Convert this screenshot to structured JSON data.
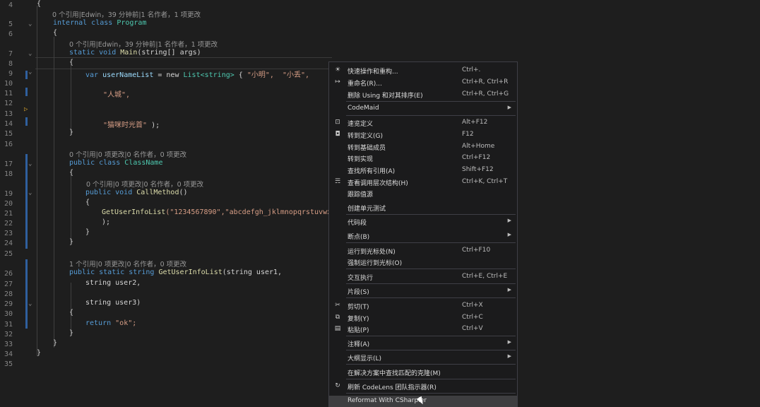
{
  "editor": {
    "line_numbers": [
      "4",
      "5",
      "6",
      "7",
      "8",
      "9",
      "10",
      "11",
      "12",
      "13",
      "14",
      "15",
      "16",
      "17",
      "18",
      "19",
      "20",
      "21",
      "22",
      "23",
      "24",
      "25",
      "26",
      "27",
      "28",
      "29",
      "30",
      "31",
      "32",
      "33",
      "34",
      "35"
    ],
    "codelens": {
      "program": "0 个引用|Edwin，39 分钟前|1 名作者，1 项更改",
      "main": "0 个引用|Edwin，39 分钟前|1 名作者，1 项更改",
      "classname": "0 个引用|0 项更改|0 名作者，0 项更改",
      "callmethod": "0 个引用|0 项更改|0 名作者，0 项更改",
      "getuserinfolist": "1 个引用|0 项更改|0 名作者，0 项更改"
    },
    "code": {
      "l4": "{",
      "l5_kw": "internal class",
      "l5_name": "Program",
      "l6": "{",
      "l7_kw": "static void",
      "l7_fn": "Main",
      "l7_rest": "(string[] args)",
      "l8": "{",
      "l9_a": "var",
      "l9_b": "userNameList",
      "l9_c": "= new",
      "l9_d": "List<string>",
      "l9_e": "{",
      "l9_s1": "\"小明\",",
      "l9_s2": "\"小丢\",",
      "l11": "\"人城\",",
      "l14_s": "\"猫咪时光首\"",
      "l14_end": ");",
      "l15": "}",
      "l17_kw": "public class",
      "l17_name": "ClassName",
      "l18": "{",
      "l19_kw": "public void",
      "l19_fn": "CallMethod",
      "l19_rest": "()",
      "l20": "{",
      "l21_fn": "GetUserInfoList",
      "l21_args": "(\"1234567890\",\"abcdefgh_jklmnopqrstuvwx",
      "l22": ");",
      "l23": "}",
      "l24": "}",
      "l26_kw": "public static string",
      "l26_fn": "GetUserInfoList",
      "l26_rest": "(string user1,",
      "l27": "string user2,",
      "l29": "string user3)",
      "l30": "{",
      "l31_kw": "return",
      "l31_s": "\"ok\";",
      "l32": "}",
      "l33": "}",
      "l34": "}"
    }
  },
  "context_menu": {
    "items": [
      {
        "icon": "lightbulb-icon",
        "glyph": "☀",
        "label": "快速操作和重构...",
        "shortcut": "Ctrl+."
      },
      {
        "icon": "rename-icon",
        "glyph": "↦",
        "label": "重命名(R)...",
        "shortcut": "Ctrl+R, Ctrl+R"
      },
      {
        "icon": "",
        "glyph": "",
        "label": "删除 Using 和对其排序(E)",
        "shortcut": "Ctrl+R, Ctrl+G"
      },
      {
        "icon": "",
        "glyph": "",
        "label": "CodeMaid",
        "shortcut": "",
        "submenu": true
      },
      {
        "icon": "peek-definition-icon",
        "glyph": "⊡",
        "label": "速览定义",
        "shortcut": "Alt+F12"
      },
      {
        "icon": "goto-definition-icon",
        "glyph": "◘",
        "label": "转到定义(G)",
        "shortcut": "F12"
      },
      {
        "icon": "",
        "glyph": "",
        "label": "转到基础成员",
        "shortcut": "Alt+Home"
      },
      {
        "icon": "",
        "glyph": "",
        "label": "转到实现",
        "shortcut": "Ctrl+F12"
      },
      {
        "icon": "",
        "glyph": "",
        "label": "查找所有引用(A)",
        "shortcut": "Shift+F12"
      },
      {
        "icon": "call-hierarchy-icon",
        "glyph": "☴",
        "label": "查看调用层次结构(H)",
        "shortcut": "Ctrl+K, Ctrl+T"
      },
      {
        "icon": "",
        "glyph": "",
        "label": "跟踪值源",
        "shortcut": ""
      },
      {
        "icon": "",
        "glyph": "",
        "label": "创建单元测试",
        "shortcut": ""
      },
      {
        "icon": "",
        "glyph": "",
        "label": "代码段",
        "shortcut": "",
        "submenu": true
      },
      {
        "icon": "",
        "glyph": "",
        "label": "断点(B)",
        "shortcut": "",
        "submenu": true
      },
      {
        "icon": "",
        "glyph": "",
        "label": "运行到光标处(N)",
        "shortcut": "Ctrl+F10"
      },
      {
        "icon": "",
        "glyph": "",
        "label": "强制运行到光标(O)",
        "shortcut": ""
      },
      {
        "icon": "",
        "glyph": "",
        "label": "交互执行",
        "shortcut": "Ctrl+E, Ctrl+E"
      },
      {
        "icon": "",
        "glyph": "",
        "label": "片段(S)",
        "shortcut": "",
        "submenu": true
      },
      {
        "icon": "cut-icon",
        "glyph": "✂",
        "label": "剪切(T)",
        "shortcut": "Ctrl+X"
      },
      {
        "icon": "copy-icon",
        "glyph": "⧉",
        "label": "复制(Y)",
        "shortcut": "Ctrl+C"
      },
      {
        "icon": "paste-icon",
        "glyph": "▤",
        "label": "粘贴(P)",
        "shortcut": "Ctrl+V"
      },
      {
        "icon": "",
        "glyph": "",
        "label": "注释(A)",
        "shortcut": "",
        "submenu": true
      },
      {
        "icon": "",
        "glyph": "",
        "label": "大纲显示(L)",
        "shortcut": "",
        "submenu": true
      },
      {
        "icon": "",
        "glyph": "",
        "label": "在解决方案中查找匹配的克隆(M)",
        "shortcut": ""
      },
      {
        "icon": "refresh-icon",
        "glyph": "↻",
        "label": "刷新 CodeLens 团队指示器(R)",
        "shortcut": ""
      },
      {
        "icon": "",
        "glyph": "",
        "label": "Reformat With CSharpier",
        "shortcut": ""
      }
    ]
  },
  "colors": {
    "background": "#1e1e1e",
    "menu_background": "#1b1b1c",
    "menu_hover": "#3e3e40",
    "keyword": "#569cd6",
    "type": "#4ec9b0",
    "method": "#dcdcaa",
    "string": "#d69d85"
  }
}
